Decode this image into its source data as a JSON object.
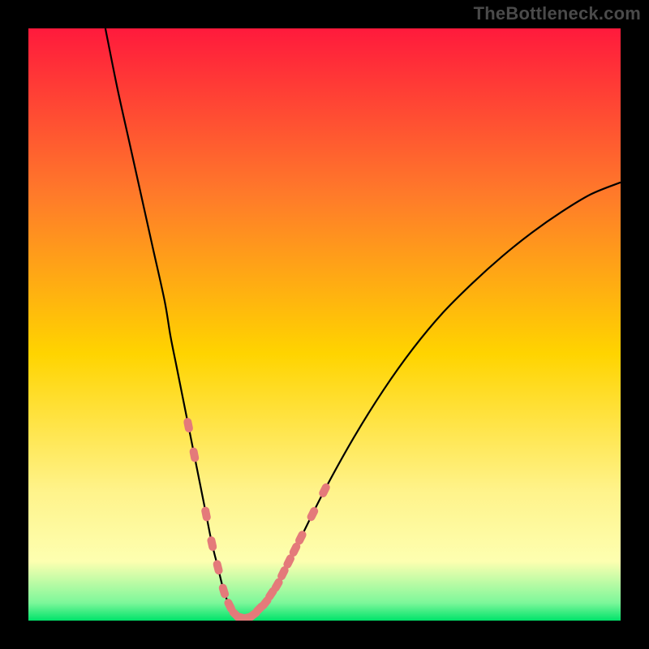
{
  "watermark": "TheBottleneck.com",
  "colors": {
    "frame_background": "#000000",
    "gradient_top": "#ff1a3c",
    "gradient_mid_upper": "#ff7a2a",
    "gradient_mid": "#ffd400",
    "gradient_lower": "#fff38a",
    "gradient_band": "#fdffb0",
    "gradient_bottom": "#00e36a",
    "curve_stroke": "#000000",
    "marker_fill": "#e47a7a"
  },
  "chart_data": {
    "type": "line",
    "title": "",
    "xlabel": "",
    "ylabel": "",
    "xlim": [
      0,
      100
    ],
    "ylim": [
      0,
      100
    ],
    "series": [
      {
        "name": "bottleneck-curve",
        "x": [
          13,
          15,
          17,
          19,
          21,
          23,
          24,
          25,
          26,
          27,
          28,
          29,
          30,
          31,
          32,
          33,
          34,
          35,
          36,
          37,
          38,
          40,
          42,
          44,
          46,
          50,
          55,
          60,
          65,
          70,
          75,
          80,
          85,
          90,
          95,
          100
        ],
        "values": [
          100,
          90,
          81,
          72,
          63,
          54,
          48,
          43,
          38,
          33,
          28,
          23,
          18,
          13,
          9,
          5,
          2.5,
          1,
          0.5,
          0.5,
          1,
          3,
          6,
          10,
          14,
          22,
          31,
          39,
          46,
          52,
          57,
          61.5,
          65.5,
          69,
          72,
          74
        ]
      }
    ],
    "markers": {
      "name": "highlighted-points",
      "x": [
        27,
        28,
        30,
        31,
        32,
        33,
        34,
        35,
        36,
        37,
        38,
        39,
        40,
        41,
        42,
        43,
        44,
        45,
        46,
        48,
        50
      ],
      "values": [
        33,
        28,
        18,
        13,
        9,
        5,
        2.5,
        1,
        0.5,
        0.5,
        1,
        2,
        3,
        4.5,
        6,
        8,
        10,
        12,
        14,
        18,
        22
      ]
    }
  }
}
